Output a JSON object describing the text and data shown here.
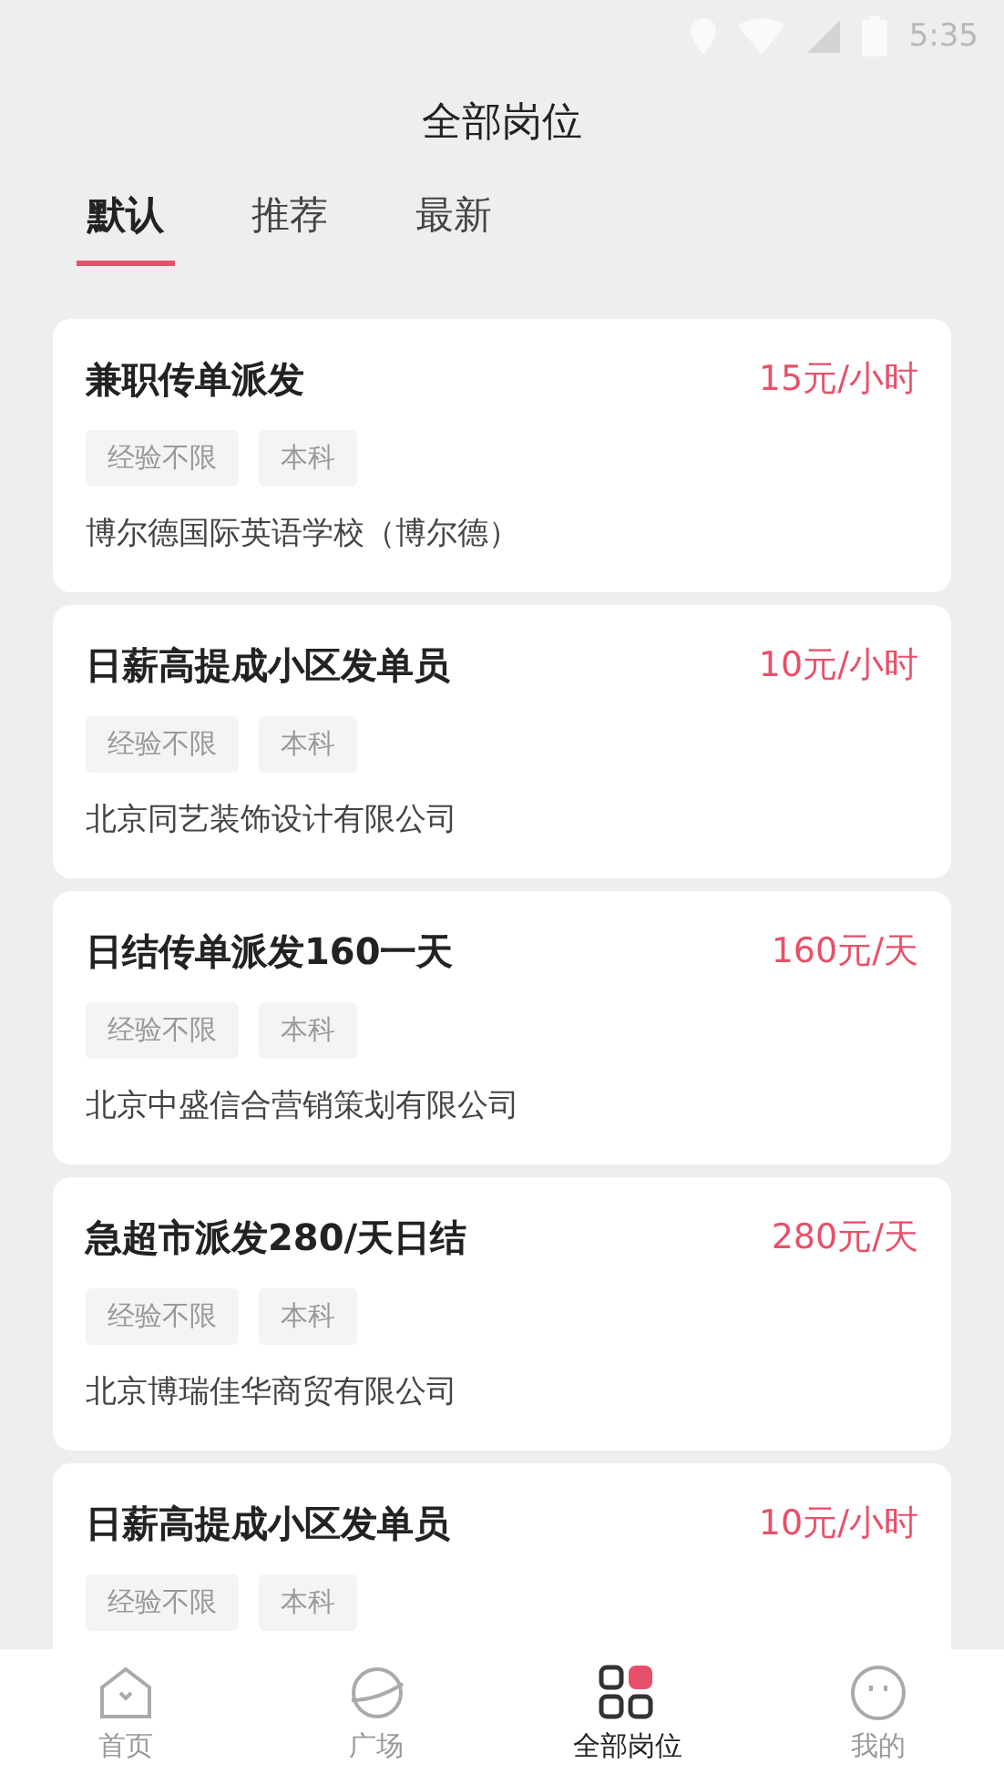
{
  "status_bar": {
    "time": "5:35"
  },
  "title": "全部岗位",
  "tabs": [
    {
      "label": "默认",
      "selected": true
    },
    {
      "label": "推荐",
      "selected": false
    },
    {
      "label": "最新",
      "selected": false
    }
  ],
  "jobs": [
    {
      "title": "兼职传单派发",
      "pay": "15元/小时",
      "tags": [
        "经验不限",
        "本科"
      ],
      "company": "博尔德国际英语学校（博尔德）"
    },
    {
      "title": "日薪高提成小区发单员",
      "pay": "10元/小时",
      "tags": [
        "经验不限",
        "本科"
      ],
      "company": "北京同艺装饰设计有限公司"
    },
    {
      "title": "日结传单派发160一天",
      "pay": "160元/天",
      "tags": [
        "经验不限",
        "本科"
      ],
      "company": "北京中盛信合营销策划有限公司"
    },
    {
      "title": "急超市派发280/天日结",
      "pay": "280元/天",
      "tags": [
        "经验不限",
        "本科"
      ],
      "company": "北京博瑞佳华商贸有限公司"
    },
    {
      "title": "日薪高提成小区发单员",
      "pay": "10元/小时",
      "tags": [
        "经验不限",
        "本科"
      ]
    }
  ],
  "nav": [
    {
      "kind": "home",
      "label": "首页",
      "selected": false
    },
    {
      "kind": "planet",
      "label": "广场",
      "selected": false
    },
    {
      "kind": "grid",
      "label": "全部岗位",
      "selected": true
    },
    {
      "kind": "face",
      "label": "我的",
      "selected": false
    }
  ]
}
